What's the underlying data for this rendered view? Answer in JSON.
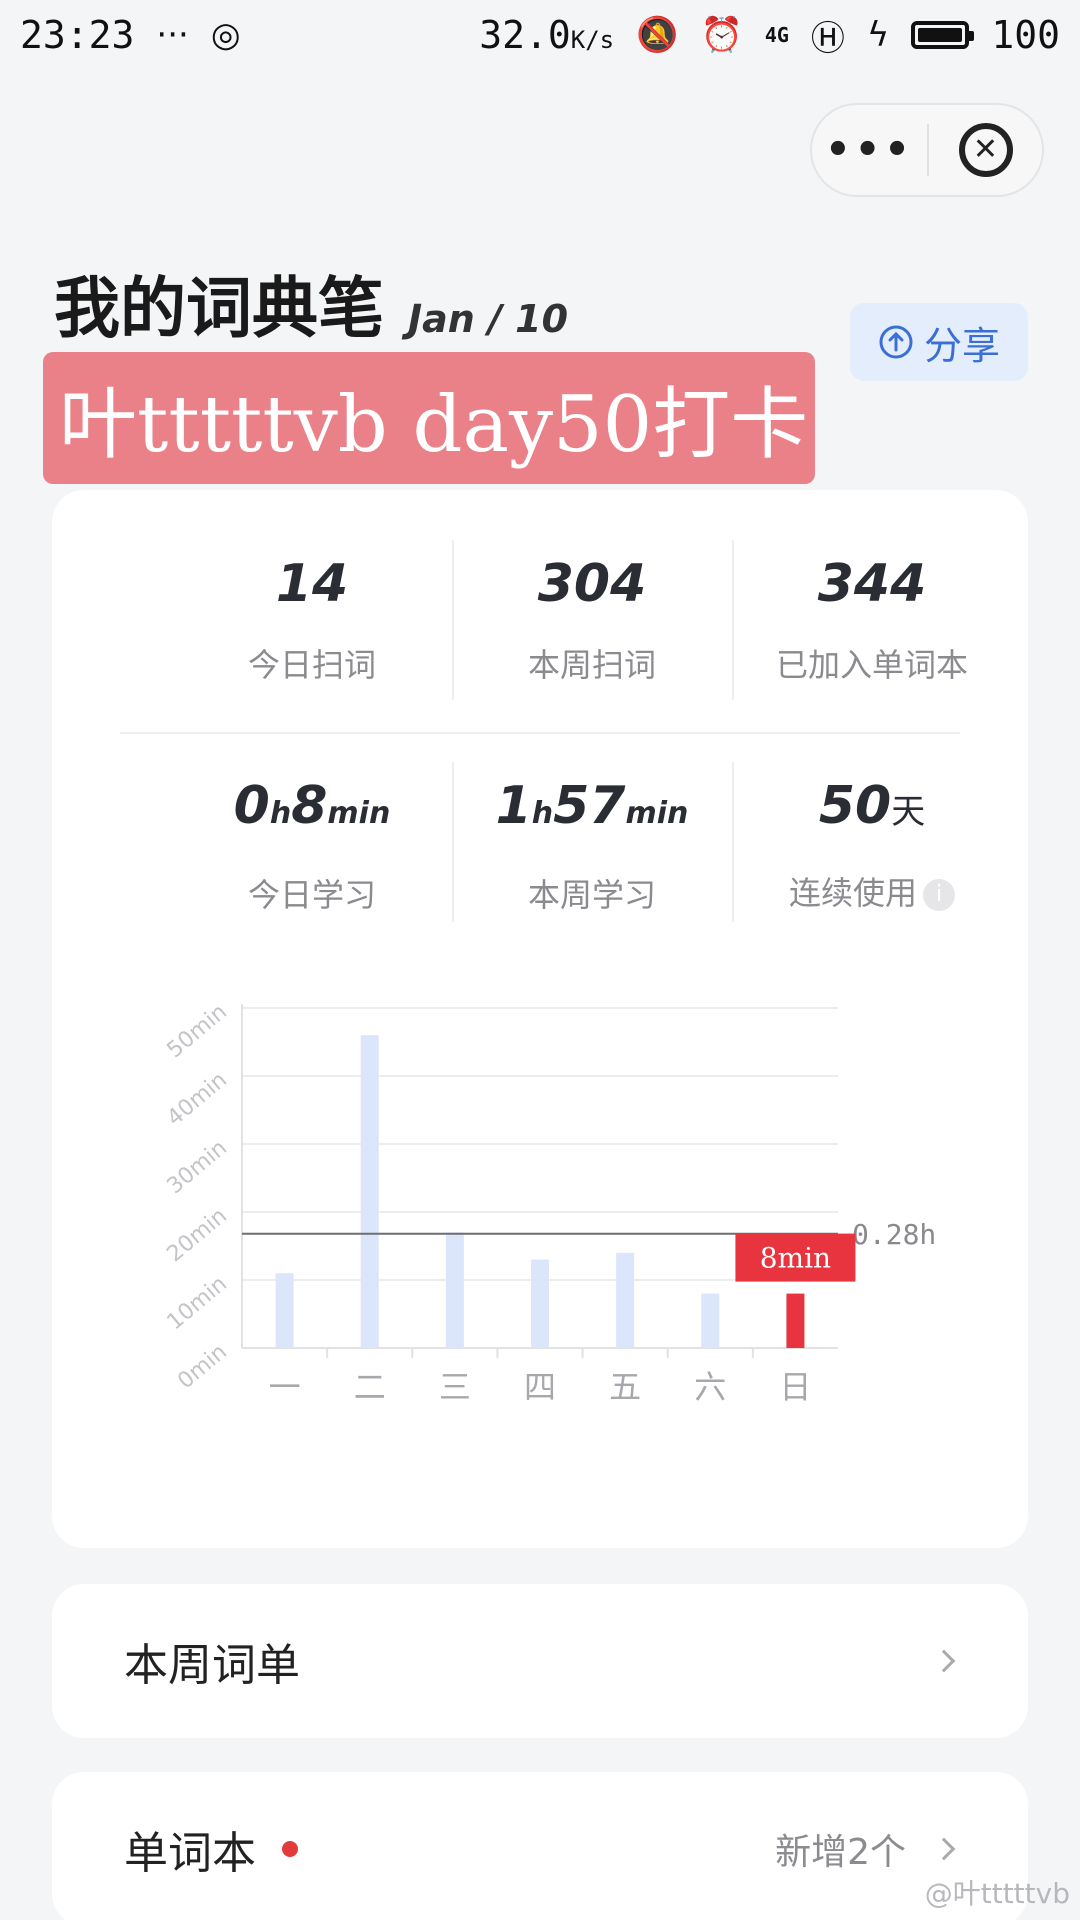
{
  "status_bar": {
    "time": "23:23",
    "dots": "···",
    "speed": "32.0",
    "speed_unit": "K/s",
    "network": "4G",
    "battery": "100"
  },
  "capsule": {
    "more": "•••",
    "close": "✕"
  },
  "header": {
    "title": "我的词典笔",
    "date": "Jan / 10",
    "share_label": "分享",
    "banner": "叶tttttvb day50打卡"
  },
  "stats": {
    "row1": [
      {
        "value": "14",
        "label": "今日扫词"
      },
      {
        "value": "304",
        "label": "本周扫词"
      },
      {
        "value": "344",
        "label": "已加入单词本"
      }
    ],
    "today_study": {
      "h": "0",
      "h_unit": "h",
      "m": "8",
      "m_unit": "min",
      "label": "今日学习"
    },
    "week_study": {
      "h": "1",
      "h_unit": "h",
      "m": "57",
      "m_unit": "min",
      "label": "本周学习"
    },
    "streak": {
      "value": "50",
      "unit": "天",
      "label": "连续使用",
      "info": "i"
    }
  },
  "chart_data": {
    "type": "bar",
    "categories": [
      "一",
      "二",
      "三",
      "四",
      "五",
      "六",
      "日"
    ],
    "values": [
      11,
      46,
      17,
      13,
      14,
      8,
      8
    ],
    "ylim": [
      0,
      50
    ],
    "y_ticks": [
      "0min",
      "10min",
      "20min",
      "30min",
      "40min",
      "50min"
    ],
    "average_line": {
      "value": 16.8,
      "label": "0.28h"
    },
    "highlight": {
      "index": 6,
      "label": "8min",
      "color": "#e8343f"
    },
    "bar_color": "#dbe6fb",
    "grid": true
  },
  "lists": {
    "weekly": {
      "title": "本周词单"
    },
    "wordbook": {
      "title": "单词本",
      "right_text": "新增2个"
    }
  },
  "watermark": "@叶tttttvb"
}
